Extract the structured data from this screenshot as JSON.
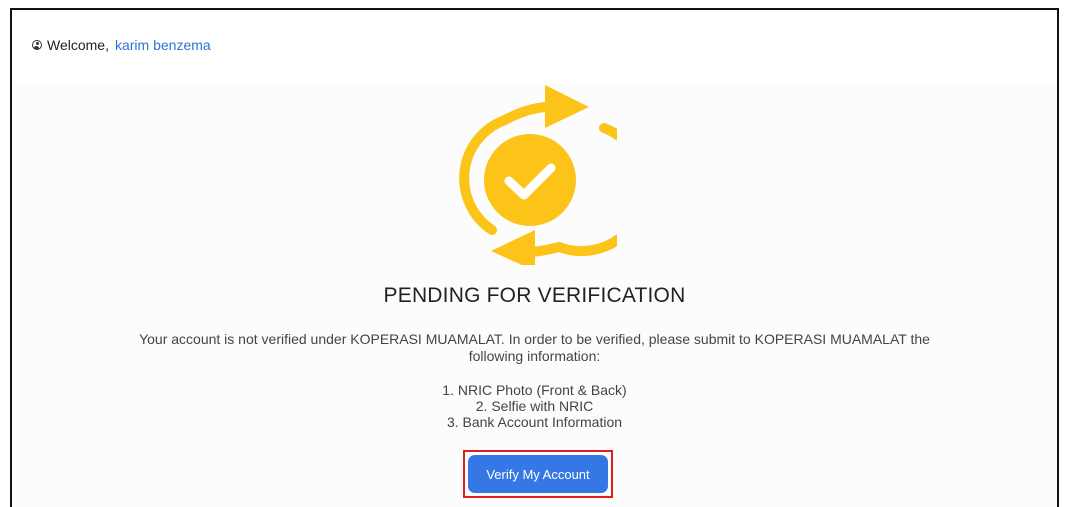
{
  "header": {
    "user_icon": "user-circle-icon",
    "welcome_label": "Welcome,",
    "username": "karim benzema"
  },
  "status": {
    "icon": "refresh-check-icon",
    "title": "PENDING FOR VERIFICATION",
    "description": "Your account is not verified under KOPERASI MUAMALAT. In order to be verified, please submit to KOPERASI MUAMALAT the following information:",
    "requirements": [
      "1. NRIC Photo (Front & Back)",
      "2. Selfie with NRIC",
      "3. Bank Account Information"
    ]
  },
  "actions": {
    "verify_label": "Verify My Account"
  },
  "colors": {
    "accent": "#3578e5",
    "link": "#2e74d6",
    "warning": "#fcc419",
    "highlight": "#e01e1e"
  }
}
